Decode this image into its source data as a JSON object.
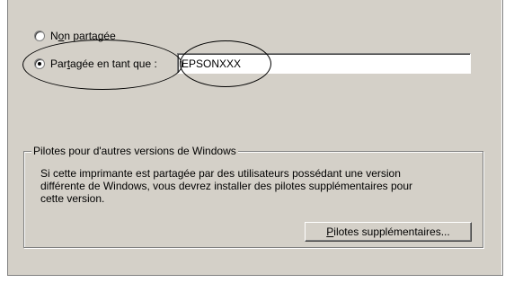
{
  "sharing": {
    "not_shared": {
      "prefix": "N",
      "underlined": "o",
      "suffix": "n partagée",
      "selected": false
    },
    "shared_as": {
      "prefix": "Par",
      "underlined": "t",
      "suffix": "agée en tant que :",
      "selected": true
    },
    "share_name_value": "EPSONXXX"
  },
  "drivers_group": {
    "legend": "Pilotes pour d'autres versions de Windows",
    "description": "Si cette imprimante est partagée par des utilisateurs possédant une version différente de Windows, vous devrez installer des pilotes supplémentaires pour cette version.",
    "button": {
      "underlined": "P",
      "rest": "ilotes supplémentaires..."
    }
  }
}
